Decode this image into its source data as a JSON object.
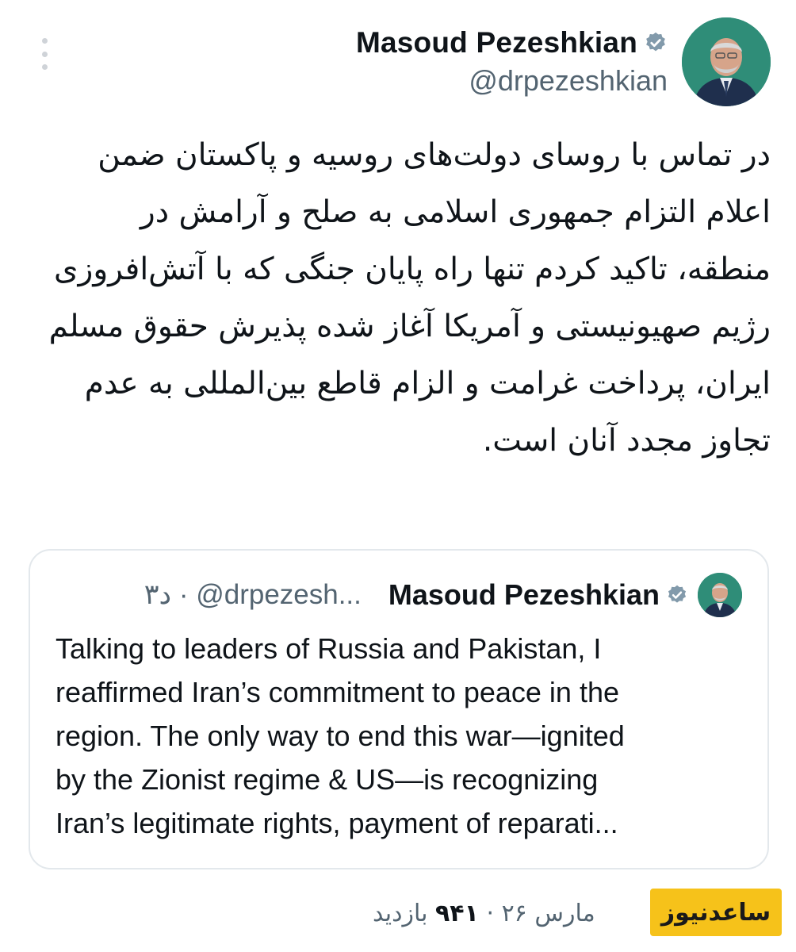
{
  "author": {
    "display_name": "Masoud Pezeshkian",
    "handle": "@drpezeshkian",
    "verified": true,
    "avatar_icon": "person-portrait-icon"
  },
  "tweet": {
    "text": "در تماس با روسای دولت‌های روسیه و پاکستان ضمن اعلام التزام جمهوری اسلامی به صلح و آرامش در منطقه، تاکید کردم تنها راه پایان جنگی که با آتش‌افروزی رژیم صهیونیستی و آمریکا آغاز شده پذیرش حقوق مسلم ایران، پرداخت غرامت و الزام قاطع بین‌المللی به عدم تجاوز مجدد آنان است."
  },
  "quoted_tweet": {
    "display_name": "Masoud Pezeshkian",
    "meta": "۳د · @drpezesh...",
    "text": "Talking to leaders of Russia and Pakistan, I\nreaffirmed Iran’s commitment to peace in the\nregion. The only way to end this war—ignited\nby the Zionist regime & US—is recognizing\nIran’s legitimate rights, payment of reparati..."
  },
  "footer": {
    "date": "مارس ۲۶",
    "separator": "·",
    "views_count": "۹۴۱",
    "views_label": "بازدید"
  },
  "watermark": {
    "text": "ساعدنیوز"
  },
  "colors": {
    "text_primary": "#0f1419",
    "text_secondary": "#536471",
    "verified_badge": "#829aab",
    "watermark_bg": "#f6c21a"
  }
}
